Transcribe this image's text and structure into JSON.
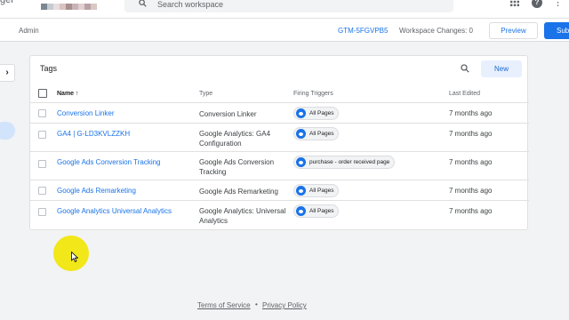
{
  "app": {
    "brand_partial": "ger"
  },
  "search": {
    "placeholder": "Search workspace"
  },
  "subbar": {
    "section": "Admin",
    "container_id": "GTM-5FGVPB5",
    "workspace_changes": "Workspace Changes: 0",
    "preview_label": "Preview",
    "submit_label": "Submit"
  },
  "tags_card": {
    "title": "Tags",
    "new_label": "New",
    "columns": {
      "name": "Name",
      "sort_indicator": "↑",
      "type": "Type",
      "triggers": "Firing Triggers",
      "edited": "Last Edited"
    },
    "rows": [
      {
        "name": "Conversion Linker",
        "type": "Conversion Linker",
        "trigger": "All Pages",
        "edited": "7 months ago"
      },
      {
        "name": "GA4 | G-LD3KVLZZKH",
        "type": "Google Analytics: GA4 Configuration",
        "trigger": "All Pages",
        "edited": "7 months ago"
      },
      {
        "name": "Google Ads Conversion Tracking",
        "type": "Google Ads Conversion Tracking",
        "trigger": "purchase - order received page",
        "edited": "7 months ago"
      },
      {
        "name": "Google Ads Remarketing",
        "type": "Google Ads Remarketing",
        "trigger": "All Pages",
        "edited": "7 months ago"
      },
      {
        "name": "Google Analytics Universal Analytics",
        "type": "Google Analytics: Universal Analytics",
        "trigger": "All Pages",
        "edited": "7 months ago"
      }
    ]
  },
  "footer": {
    "terms": "Terms of Service",
    "separator": "•",
    "privacy": "Privacy Policy"
  },
  "icons": {
    "search": "search-icon",
    "apps": "apps-grid-icon",
    "help": "help-icon",
    "more": "more-vert-icon",
    "side_toggle": "chevron-right-icon",
    "trigger": "eye-icon",
    "cursor": "cursor-icon"
  },
  "colors": {
    "accent": "#1a73e8",
    "chip_icon": "#1a73e8",
    "highlight": "#f2e600"
  }
}
